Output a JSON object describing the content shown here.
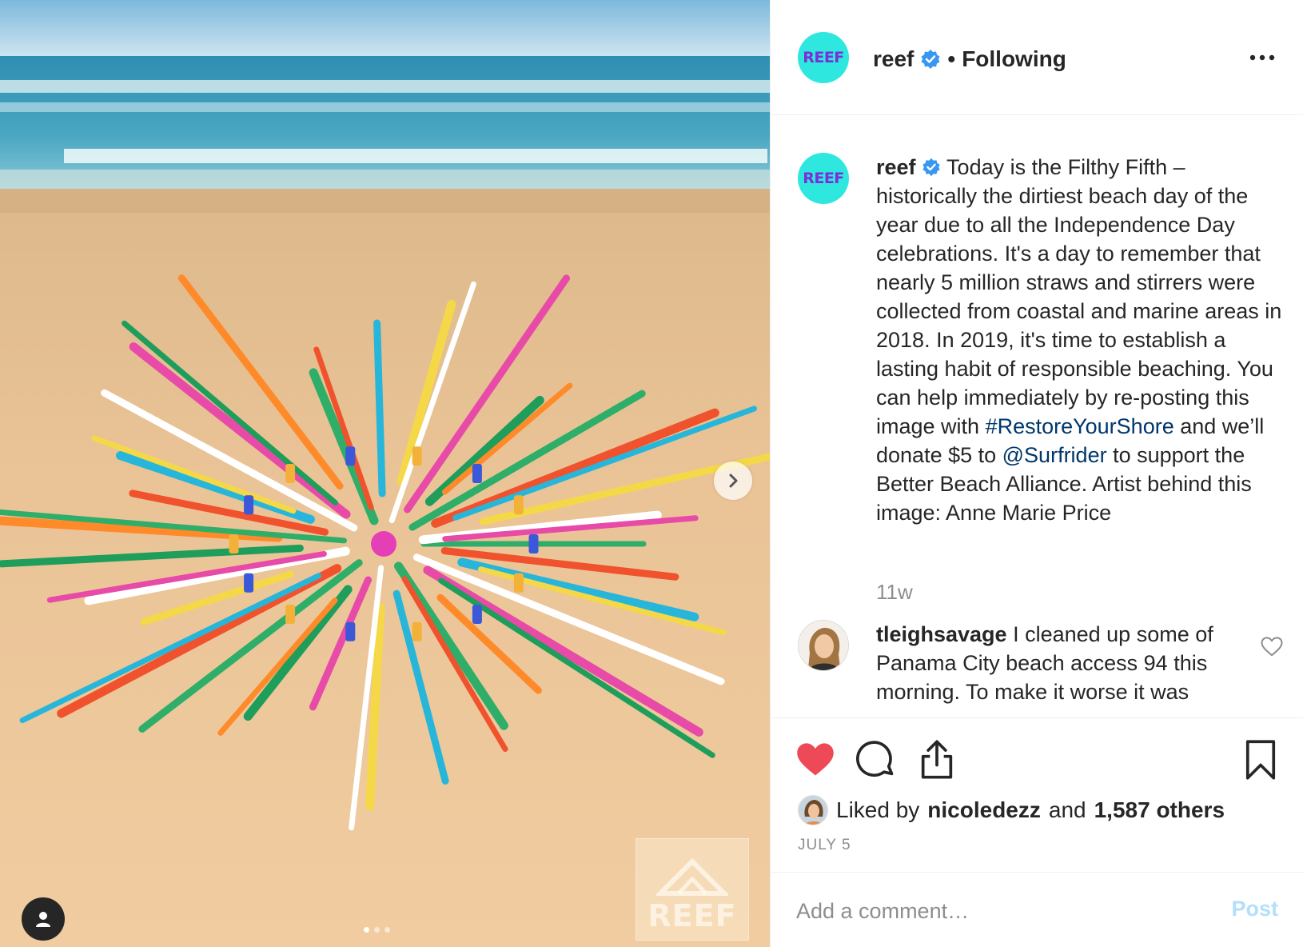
{
  "post": {
    "username": "reef",
    "separator": "•",
    "follow_status": "Following",
    "avatar_text": "REEF",
    "watermark_text": "REEF",
    "caption": {
      "username": "reef",
      "text_1": " Today is the Filthy Fifth – historically the dirtiest beach day of the year due to all the Independence Day celebrations. It's a day to remember that nearly 5 million straws and stirrers were collected from coastal and marine areas in 2018. In 2019, it's time to establish a lasting habit of responsible beaching. You can help immediately by re-posting this image with ",
      "hashtag": "#RestoreYourShore",
      "text_2": " and we’ll donate $5 to ",
      "mention": "@Surfrider",
      "text_3": " to support the Better Beach Alliance. Artist behind this image: Anne Marie Price"
    },
    "time_ago": "11w",
    "comments": [
      {
        "username": "tleighsavage",
        "text": " I cleaned up some of Panama City beach access 94 this morning. To make it worse it was"
      }
    ],
    "likes": {
      "prefix": "Liked by",
      "first_user": "nicoledezz",
      "conjunction": "and",
      "others": "1,587 others"
    },
    "date": "JULY 5",
    "add_comment_placeholder": "Add a comment…",
    "post_button_label": "Post",
    "carousel": {
      "total": 3,
      "active": 1
    }
  },
  "colors": {
    "like_red": "#ed4956",
    "link_blue": "#00376b",
    "verified_blue": "#3897f0",
    "muted": "#8e8e8e",
    "post_disabled": "#b2dffc",
    "reef_teal": "#2ee8e0",
    "reef_purple": "#7b2fd6"
  },
  "icons": [
    "verified-badge-icon",
    "more-options-icon",
    "heart-icon",
    "comment-icon",
    "share-icon",
    "bookmark-icon",
    "chevron-right-icon",
    "user-tag-icon"
  ]
}
